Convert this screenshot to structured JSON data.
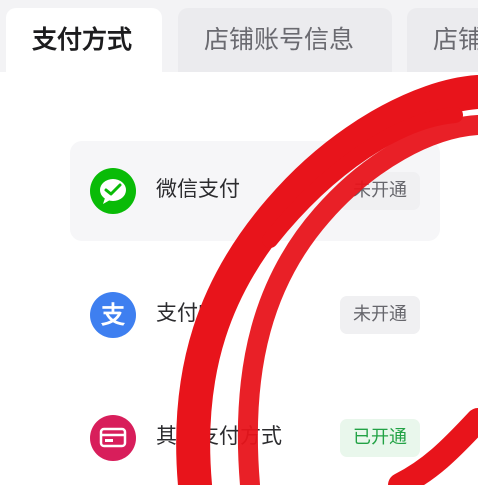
{
  "tabs": [
    {
      "label": "支付方式",
      "active": true
    },
    {
      "label": "店铺账号信息",
      "active": false
    },
    {
      "label": "店铺",
      "active": false
    }
  ],
  "payment_methods": [
    {
      "label": "微信支付",
      "status": "未开通",
      "icon": "wechat-pay-icon",
      "color": "#09bb07"
    },
    {
      "label": "支付宝",
      "status": "未开通",
      "icon": "alipay-icon",
      "color": "#3e7ff0"
    },
    {
      "label": "其他支付方式",
      "status": "已开通",
      "icon": "other-payment-icon",
      "color": "#d81e5b"
    }
  ],
  "colors": {
    "status_off_text": "#66666c",
    "status_on_text": "#22a245",
    "annotation": "#e8141b"
  }
}
